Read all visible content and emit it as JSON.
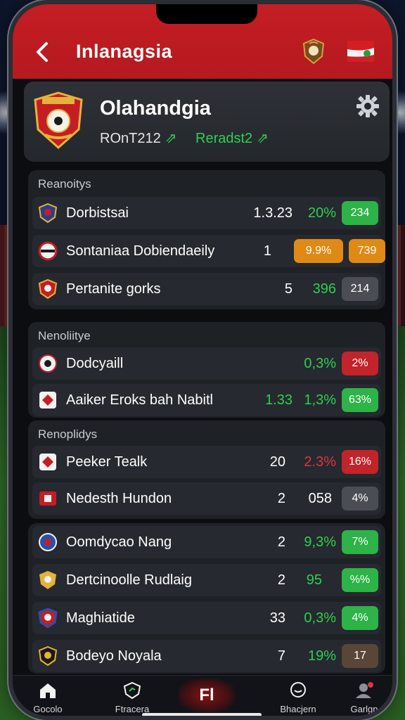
{
  "header": {
    "back_icon": "chevron-left-icon",
    "title": "Inlanagsia"
  },
  "team": {
    "name": "Olahandgia",
    "stat1": "ROnT212",
    "stat2": "Reradst2",
    "trend_icon": "trend-up-icon"
  },
  "sections": [
    {
      "title": "Reanoitys",
      "rows": [
        {
          "name": "Dorbistsai",
          "num": "1.3.23",
          "pct": "20%",
          "pct_color": "#2fcf4e",
          "badge": "234",
          "badge_color": "#2db347"
        },
        {
          "name": "Sontaniaa Dobiendaeily",
          "num": "1",
          "pct": "9.9%",
          "pct_color": "#ffffff",
          "pct_bg": "#e08a16",
          "badge": "739",
          "badge_color": "#e08a16"
        },
        {
          "name": "Pertanite gorks",
          "num": "5",
          "pct": "396",
          "pct_color": "#2fcf4e",
          "badge": "214",
          "badge_color": "#4a4d54"
        }
      ]
    },
    {
      "title": "Nenoliitye",
      "rows": [
        {
          "name": "Dodcyaill",
          "num": "",
          "pct": "0,3%",
          "pct_color": "#2fcf4e",
          "badge": "2%",
          "badge_color": "#c3232a"
        },
        {
          "name": "Aaiker Eroks bah Nabitl",
          "num": "1.33",
          "pct": "1,3%",
          "pct_color": "#2fcf4e",
          "badge": "63%",
          "badge_color": "#2db347",
          "num_color": "#2fcf4e"
        }
      ]
    },
    {
      "title": "Renoplidys",
      "rows": [
        {
          "name": "Peeker Tealk",
          "num": "20",
          "pct": "2.3%",
          "pct_color": "#e0353a",
          "badge": "16%",
          "badge_color": "#c3232a"
        },
        {
          "name": "Nedesth Hundon",
          "num": "2",
          "pct": "058",
          "pct_color": "#ffffff",
          "badge": "4%",
          "badge_color": "#4a4d54"
        }
      ]
    },
    {
      "title": "",
      "rows": [
        {
          "name": "Oomdycao Nang",
          "num": "2",
          "pct": "9,3%",
          "pct_color": "#2fcf4e",
          "badge": "7%",
          "badge_color": "#2db347"
        },
        {
          "name": "Dertcinoolle Rudlaig",
          "num": "2",
          "pct": "95",
          "pct_color": "#2fcf4e",
          "badge": "%%",
          "badge_color": "#2db347"
        },
        {
          "name": "Maghiatide",
          "num": "33",
          "pct": "0,3%",
          "pct_color": "#2fcf4e",
          "badge": "4%",
          "badge_color": "#2db347"
        },
        {
          "name": "Bodeyo Noyala",
          "num": "7",
          "pct": "19%",
          "pct_color": "#2fcf4e",
          "badge": "17",
          "badge_color": "#5a4636"
        }
      ]
    }
  ],
  "nav": {
    "items": [
      {
        "label": "Gocolo",
        "icon": "home-icon"
      },
      {
        "label": "Ftracera",
        "icon": "shield-icon"
      },
      {
        "label": "Fl",
        "icon": "center-logo"
      },
      {
        "label": "Bhacjern",
        "icon": "chat-icon"
      },
      {
        "label": "Garlgn",
        "icon": "profile-icon"
      }
    ]
  }
}
